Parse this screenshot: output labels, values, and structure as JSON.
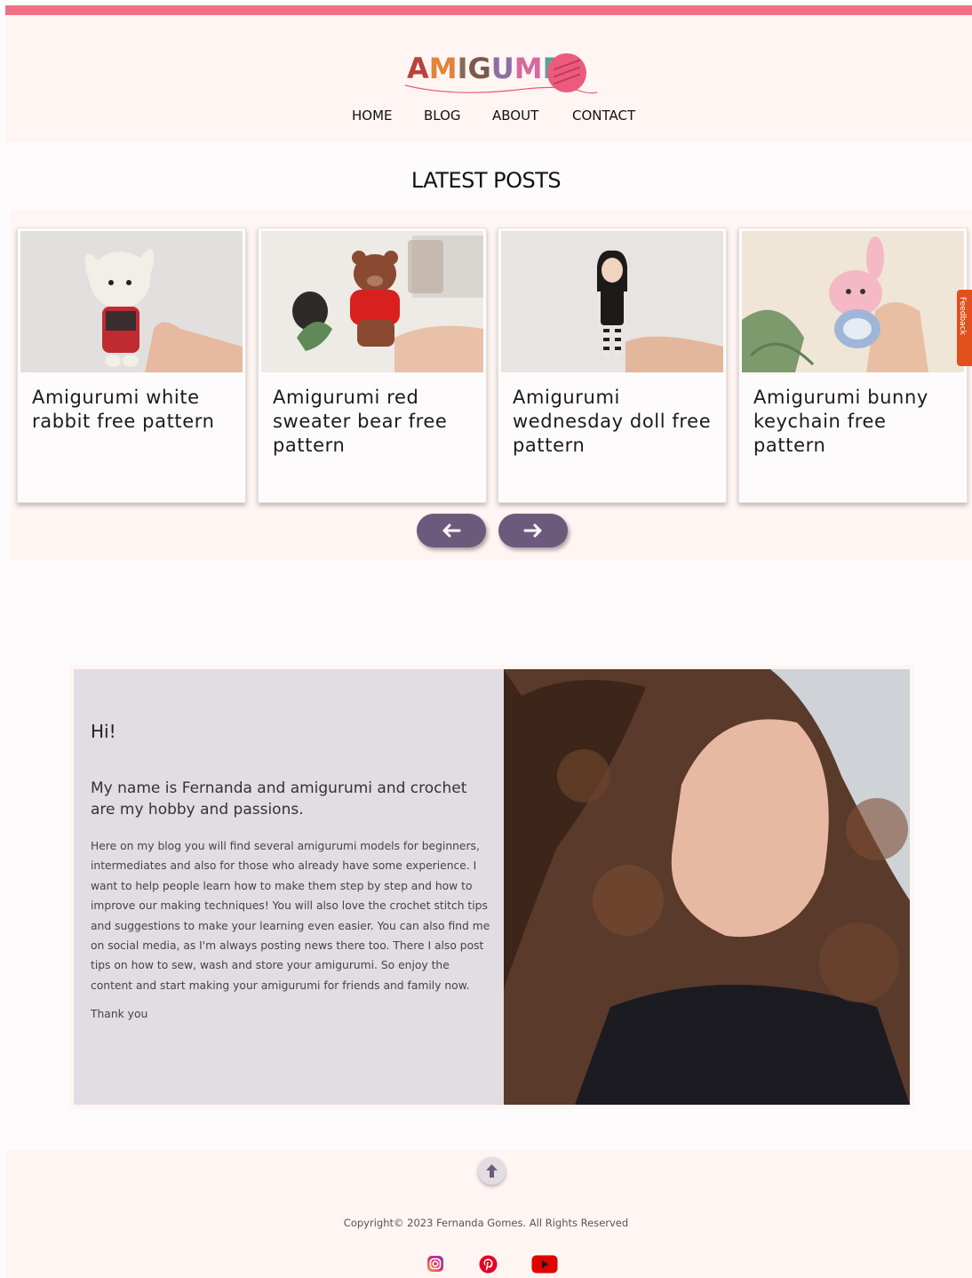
{
  "brand": {
    "logo_text": "AMIGUME"
  },
  "nav": {
    "items": [
      {
        "label": "HOME"
      },
      {
        "label": "BLOG"
      },
      {
        "label": "ABOUT"
      },
      {
        "label": "CONTACT"
      }
    ]
  },
  "latest": {
    "title": "LATEST POSTS",
    "posts": [
      {
        "title": "Amigurumi white rabbit free pattern"
      },
      {
        "title": "Amigurumi red sweater bear free pattern"
      },
      {
        "title": "Amigurumi wednesday doll free pattern"
      },
      {
        "title": "Amigurumi bunny keychain free pattern"
      }
    ]
  },
  "feedback": {
    "label": "Feedback"
  },
  "about": {
    "greeting": "Hi!",
    "lead": "My name is Fernanda and amigurumi and crochet are my hobby and passions.",
    "body": "Here on my blog you will find several amigurumi models for beginners, intermediates and also for those who already have some experience. I want to help people learn how to make them step by step and how to improve our making techniques! You will also love the crochet stitch tips and suggestions to make your learning even easier. You can also find me on social media, as I'm always posting news there too. There I also post tips on how to sew, wash and store your amigurumi. So enjoy the content and start making your amigurumi for friends and family now.",
    "closing": "Thank you"
  },
  "footer": {
    "copyright": "Copyright© 2023 Fernanda Gomes. All Rights Reserved"
  },
  "colors": {
    "accent": "#ef7183",
    "panel": "#fff5f3",
    "button": "#6c5a7d",
    "about_bg": "#e1dde3"
  },
  "icons": [
    "arrow-left-icon",
    "arrow-right-icon",
    "arrow-up-icon",
    "instagram-icon",
    "pinterest-icon",
    "youtube-icon"
  ]
}
